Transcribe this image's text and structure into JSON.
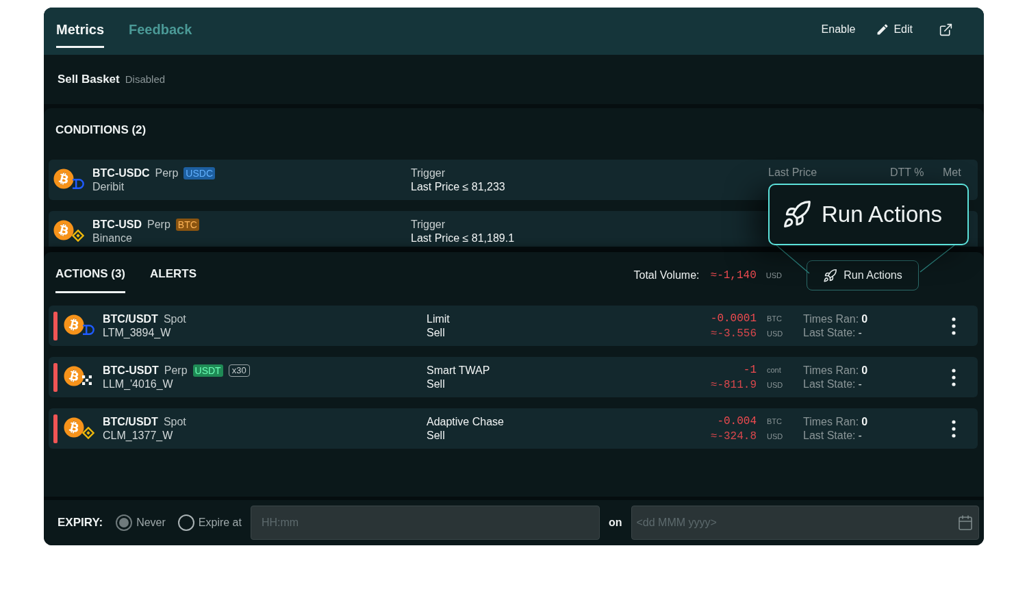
{
  "header": {
    "tabs": [
      {
        "label": "Metrics",
        "selected": true
      },
      {
        "label": "Feedback",
        "selected": false
      }
    ],
    "enable": "Enable",
    "edit": "Edit"
  },
  "basket": {
    "name": "Sell Basket",
    "status": "Disabled"
  },
  "conditions": {
    "title": "CONDITIONS (2)",
    "columns": [
      "Last Price",
      "DTT %",
      "Met"
    ],
    "rows": [
      {
        "pair": "BTC-USDC",
        "market": "Perp",
        "tags": [
          {
            "label": "USDC",
            "kind": "filled",
            "color": "#1d5fa0"
          }
        ],
        "venue": "Deribit",
        "venue_mark": {
          "kind": "d-mark"
        },
        "label": "Trigger",
        "rule": "Last Price ≤ 81,233"
      },
      {
        "pair": "BTC-USD",
        "market": "Perp",
        "tags": [
          {
            "label": "BTC",
            "kind": "filled",
            "color": "#8a5410"
          }
        ],
        "venue": "Binance",
        "venue_mark": {
          "kind": "diamond"
        },
        "label": "Trigger",
        "rule": "Last Price ≤ 81,189.1"
      }
    ]
  },
  "actions": {
    "tabs": [
      {
        "label": "ACTIONS (3)",
        "selected": true
      },
      {
        "label": "ALERTS",
        "selected": false
      }
    ],
    "total": {
      "label": "Total Volume:",
      "value": "≈-1,140",
      "unit": "USD"
    },
    "run_button": "Run Actions",
    "callout": "Run Actions",
    "rows": [
      {
        "pair": "BTC/USDT",
        "market": "Spot",
        "name": "LTM_3894_W",
        "venue_mark": {
          "kind": "d-mark"
        },
        "order_type": "Limit",
        "side": "Sell",
        "quantity": "-0.0001",
        "quantity_unit": "BTC",
        "notional": "≈-3.556",
        "notional_unit": "USD",
        "times_ran_label": "Times Ran:",
        "times_ran": "0",
        "last_state_label": "Last State:",
        "last_state": "-"
      },
      {
        "pair": "BTC-USDT",
        "market": "Perp",
        "tags": [
          {
            "label": "USDT",
            "kind": "filled",
            "color": "#1f8a55"
          },
          {
            "label": "x30",
            "kind": "outline"
          }
        ],
        "name": "LLM_'4016_W",
        "venue_mark": {
          "kind": "checker"
        },
        "order_type": "Smart TWAP",
        "side": "Sell",
        "quantity": "-1",
        "quantity_unit": "cont",
        "notional": "≈-811.9",
        "notional_unit": "USD",
        "times_ran_label": "Times Ran:",
        "times_ran": "0",
        "last_state_label": "Last State:",
        "last_state": "-"
      },
      {
        "pair": "BTC/USDT",
        "market": "Spot",
        "name": "CLM_1377_W",
        "venue_mark": {
          "kind": "diamond"
        },
        "order_type": "Adaptive Chase",
        "side": "Sell",
        "quantity": "-0.004",
        "quantity_unit": "BTC",
        "notional": "≈-324.8",
        "notional_unit": "USD",
        "times_ran_label": "Times Ran:",
        "times_ran": "0",
        "last_state_label": "Last State:",
        "last_state": "-"
      }
    ]
  },
  "expiry": {
    "label": "EXPIRY:",
    "options": [
      {
        "label": "Never",
        "selected": true
      },
      {
        "label": "Expire at",
        "selected": false
      }
    ],
    "time": {
      "placeholder": "HH:mm"
    },
    "on": "on",
    "date": {
      "placeholder": "<dd MMM yyyy>"
    }
  }
}
